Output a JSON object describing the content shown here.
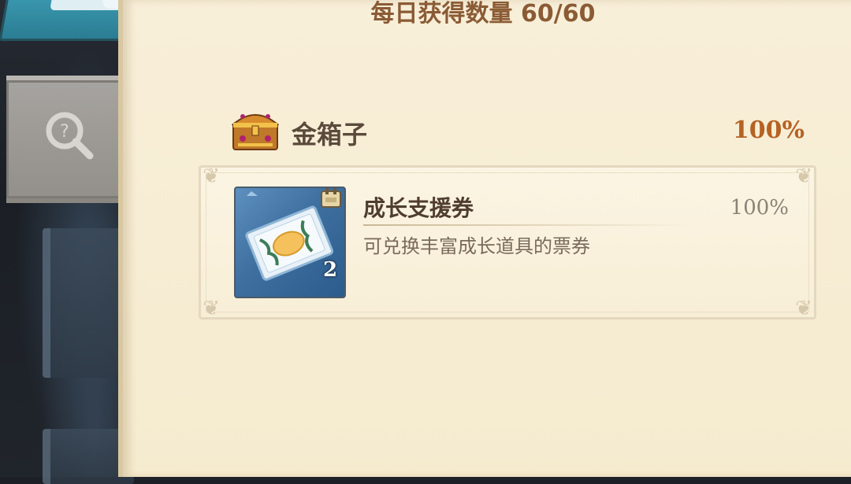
{
  "daily_limit": {
    "label": "每日获得数量 60/60"
  },
  "reward_category": {
    "name": "金箱子",
    "rate": "100%",
    "icon": "gold-chest-icon"
  },
  "reward_item": {
    "name": "成长支援券",
    "rate": "100%",
    "description": "可兑换丰富成长道具的票券",
    "count": "2",
    "icon": "growth-support-ticket-icon"
  },
  "side_nav": {
    "items": [
      {
        "icon": "menu-tab-icon"
      },
      {
        "icon": "search-magnifier-icon"
      },
      {
        "icon": "scroll-tab-icon"
      },
      {
        "icon": "scroll-tab-icon"
      }
    ]
  },
  "colors": {
    "parchment": "#f8efd9",
    "title_brown": "#8a5b35",
    "rate_orange": "#b56223",
    "tab_teal": "#3b9ab1"
  }
}
